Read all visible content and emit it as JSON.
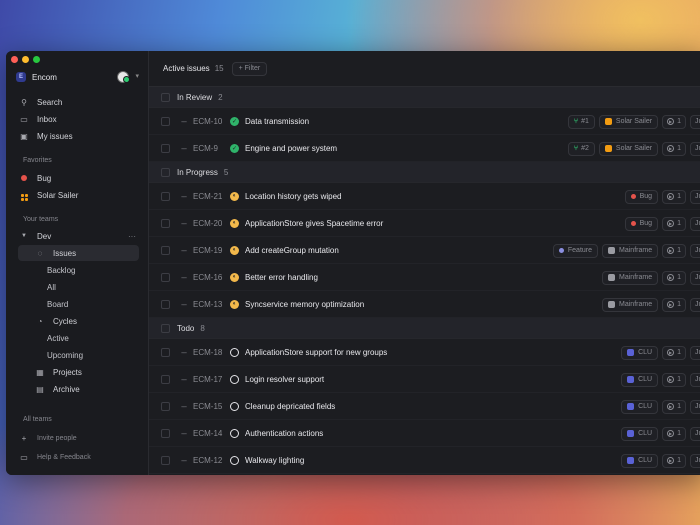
{
  "sidebar": {
    "workspace_name": "Encom",
    "workspace_initial": "E",
    "nav": {
      "search": "Search",
      "inbox": "Inbox",
      "my_issues": "My issues"
    },
    "favorites_label": "Favorites",
    "favorites": [
      {
        "label": "Bug",
        "color": "#e5534b"
      },
      {
        "label": "Solar Sailer",
        "color": "#f39c12"
      }
    ],
    "your_teams_label": "Your teams",
    "team": {
      "name": "Dev",
      "more": "···",
      "issues": "Issues",
      "backlog": "Backlog",
      "all": "All",
      "board": "Board",
      "cycles": "Cycles",
      "active": "Active",
      "upcoming": "Upcoming",
      "projects": "Projects",
      "archive": "Archive"
    },
    "all_teams_label": "All teams",
    "invite": "Invite people",
    "help": "Help & Feedback"
  },
  "header": {
    "title": "Active issues",
    "count": "15",
    "filter": "+ Filter"
  },
  "groups": {
    "review": {
      "label": "In Review",
      "count": "2"
    },
    "progress": {
      "label": "In Progress",
      "count": "5"
    },
    "todo": {
      "label": "Todo",
      "count": "8"
    }
  },
  "review_rows": [
    {
      "id": "ECM-10",
      "title": "Data transmission",
      "pr": "#1",
      "project": "Solar Sailer",
      "cycle": "1",
      "date": "Ju"
    },
    {
      "id": "ECM-9",
      "title": "Engine and power system",
      "pr": "#2",
      "project": "Solar Sailer",
      "cycle": "1",
      "date": "Ju"
    }
  ],
  "progress_rows": [
    {
      "id": "ECM-21",
      "title": "Location history gets wiped",
      "label": "Bug",
      "cycle": "1",
      "date": "Ju"
    },
    {
      "id": "ECM-20",
      "title": "ApplicationStore gives Spacetime error",
      "label": "Bug",
      "cycle": "1",
      "date": "Ju"
    },
    {
      "id": "ECM-19",
      "title": "Add createGroup mutation",
      "label": "Feature",
      "project": "Mainframe",
      "cycle": "1",
      "date": "Ju"
    },
    {
      "id": "ECM-16",
      "title": "Better error handling",
      "project": "Mainframe",
      "cycle": "1",
      "date": "Ju"
    },
    {
      "id": "ECM-13",
      "title": "Syncservice memory optimization",
      "project": "Mainframe",
      "cycle": "1",
      "date": "Ju"
    }
  ],
  "todo_rows": [
    {
      "id": "ECM-18",
      "title": "ApplicationStore support for new groups",
      "project": "CLU",
      "cycle": "1",
      "date": "Ju"
    },
    {
      "id": "ECM-17",
      "title": "Login resolver support",
      "project": "CLU",
      "cycle": "1",
      "date": "Ju"
    },
    {
      "id": "ECM-15",
      "title": "Cleanup depricated fields",
      "project": "CLU",
      "cycle": "1",
      "date": "Ju"
    },
    {
      "id": "ECM-14",
      "title": "Authentication actions",
      "project": "CLU",
      "cycle": "1",
      "date": "Ju"
    },
    {
      "id": "ECM-12",
      "title": "Walkway lighting",
      "project": "CLU",
      "cycle": "1",
      "date": "Ju"
    }
  ],
  "colors": {
    "bug": "#e5534b",
    "feature": "#8b8fe0",
    "solar": "#f39c12",
    "mainframe": "#9a9ba2",
    "clu": "#5a62d6"
  }
}
